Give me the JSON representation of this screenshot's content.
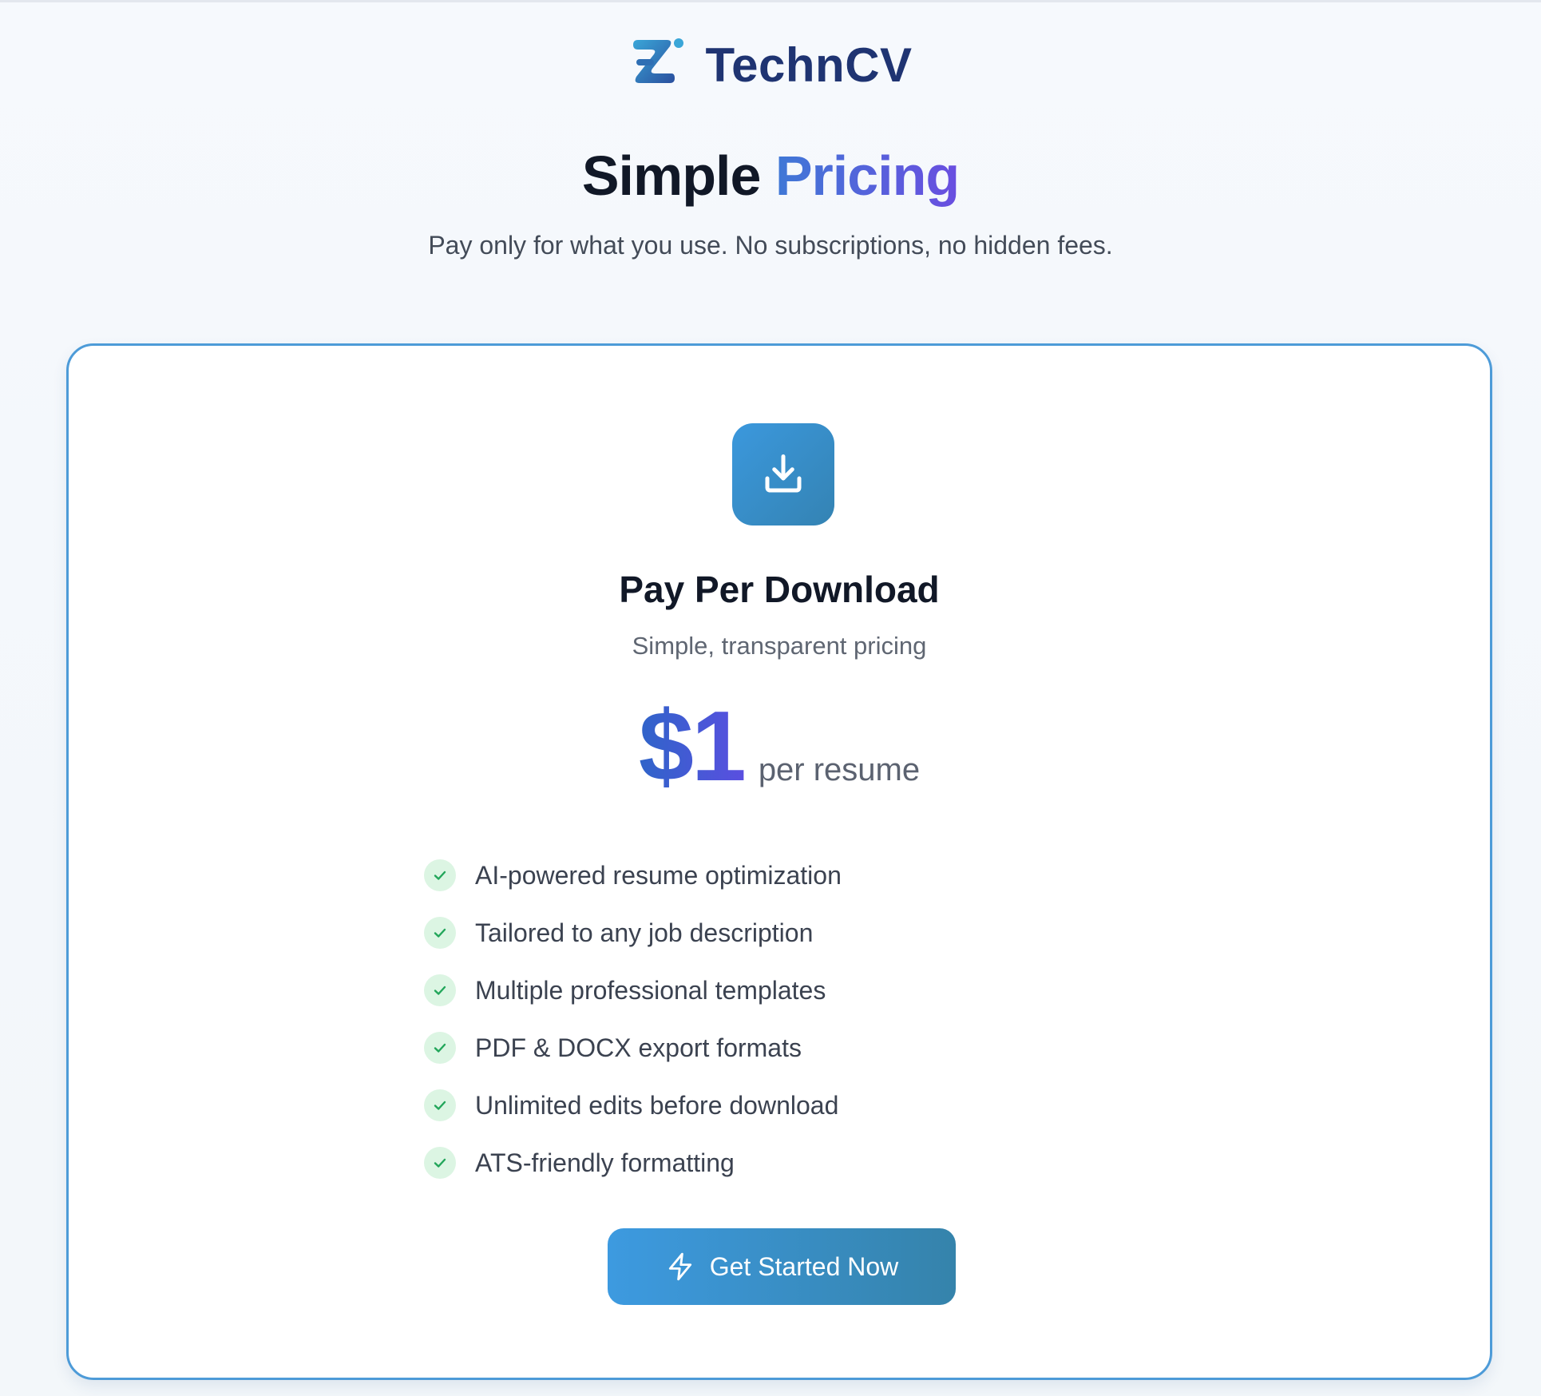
{
  "brand": {
    "name": "TechnCV",
    "logo_icon": "stylized-z-logo-icon"
  },
  "hero": {
    "title_main": "Simple",
    "title_accent": "Pricing",
    "subtitle": "Pay only for what you use. No subscriptions, no hidden fees."
  },
  "plan": {
    "icon": "download-icon",
    "title": "Pay Per Download",
    "subtitle": "Simple, transparent pricing",
    "price": "$1",
    "price_unit": "per resume",
    "features": [
      "AI-powered resume optimization",
      "Tailored to any job description",
      "Multiple professional templates",
      "PDF & DOCX export formats",
      "Unlimited edits before download",
      "ATS-friendly formatting"
    ],
    "cta_label": "Get Started Now",
    "cta_icon": "lightning-icon"
  },
  "colors": {
    "brand_navy": "#1f3472",
    "accent_blue": "#3f78d6",
    "accent_purple": "#6a4ee0",
    "card_border": "#4d9bd8",
    "button_start": "#3d9ae0",
    "button_end": "#3583ab",
    "check_green": "#22a65a"
  }
}
